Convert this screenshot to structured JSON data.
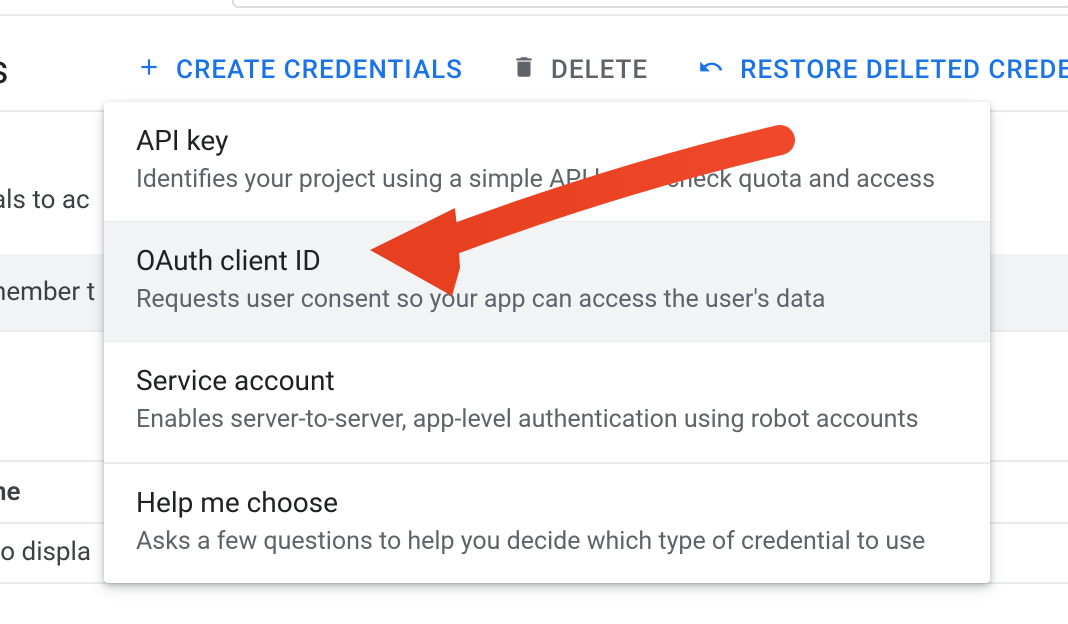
{
  "page_title_fragment": "s",
  "toolbar": {
    "create_credentials_label": "CREATE CREDENTIALS",
    "delete_label": "DELETE",
    "restore_label": "RESTORE DELETED CREDEN"
  },
  "background": {
    "row1_fragment": "als to ac",
    "row2_fragment": "nember t",
    "row3_fragment": "ne",
    "row4_fragment": " to displa"
  },
  "menu": {
    "items": [
      {
        "title": "API key",
        "desc": "Identifies your project using a simple API key to check quota and access",
        "hover": false
      },
      {
        "title": "OAuth client ID",
        "desc": "Requests user consent so your app can access the user's data",
        "hover": true
      },
      {
        "title": "Service account",
        "desc": "Enables server-to-server, app-level authentication using robot accounts",
        "hover": false
      },
      {
        "title": "Help me choose",
        "desc": "Asks a few questions to help you decide which type of credential to use",
        "hover": false,
        "separated": true
      }
    ]
  }
}
